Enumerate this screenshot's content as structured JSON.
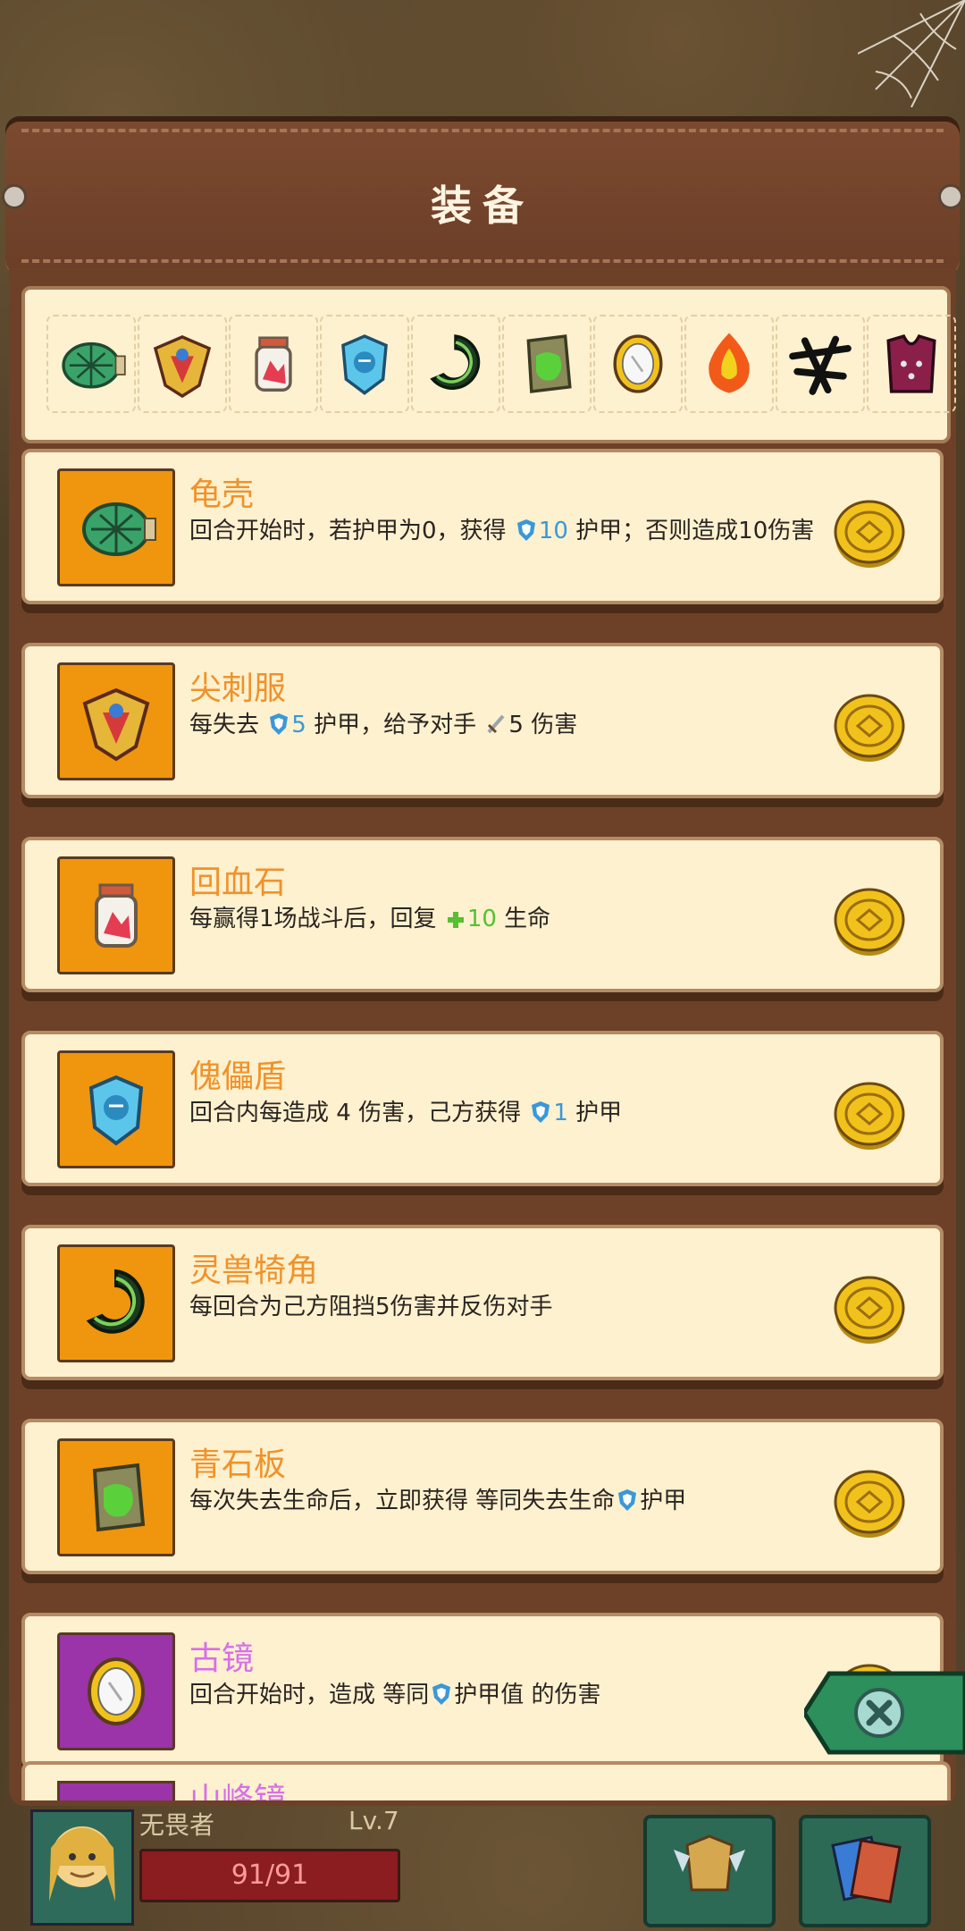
{
  "header": {
    "title": "装备"
  },
  "strip": {
    "items": [
      "turtle-shell-icon",
      "spike-armor-icon",
      "blood-jar-icon",
      "puppet-shield-icon",
      "beast-horn-icon",
      "green-slate-icon",
      "ancient-mirror-icon",
      "fire-gem-icon",
      "black-rune-icon",
      "purple-vest-icon"
    ]
  },
  "cards": [
    {
      "name": "龟壳",
      "desc_a": "回合开始时，若护甲为0，获得",
      "value": "10",
      "desc_b": "护甲；否则造成10伤害",
      "thumb_color": "#f0950e",
      "icon": "turtle-shell-icon"
    },
    {
      "name": "尖刺服",
      "desc_a": "每失去",
      "value": "5",
      "desc_b": "护甲，给予对手",
      "value2": "5",
      "desc_c": "伤害",
      "thumb_color": "#f0950e",
      "icon": "spike-armor-icon"
    },
    {
      "name": "回血石",
      "desc_a": "每赢得1场战斗后，回复",
      "value": "10",
      "desc_b": "生命",
      "thumb_color": "#f0950e",
      "icon": "blood-jar-icon"
    },
    {
      "name": "傀儡盾",
      "desc_a": "回合内每造成 4 伤害，己方获得",
      "value": "1",
      "desc_b": "护甲",
      "thumb_color": "#f0950e",
      "icon": "puppet-shield-icon"
    },
    {
      "name": "灵兽犄角",
      "desc_a": "每回合为己方阻挡5伤害并反伤对手",
      "thumb_color": "#f0950e",
      "icon": "beast-horn-icon"
    },
    {
      "name": "青石板",
      "desc_a": "每次失去生命后，立即获得 等同失去生命",
      "desc_b": "护甲",
      "thumb_color": "#f0950e",
      "icon": "green-slate-icon"
    },
    {
      "name": "古镜",
      "desc_a": "回合开始时，造成 等同",
      "desc_b": "护甲值 的伤害",
      "thumb_color": "#9a34a8",
      "name_color": "#d86fe8",
      "icon": "ancient-mirror-icon"
    }
  ],
  "partial": {
    "name": "山峰镜"
  },
  "player": {
    "name": "无畏者",
    "level": "Lv.7",
    "hp": "91/91"
  }
}
